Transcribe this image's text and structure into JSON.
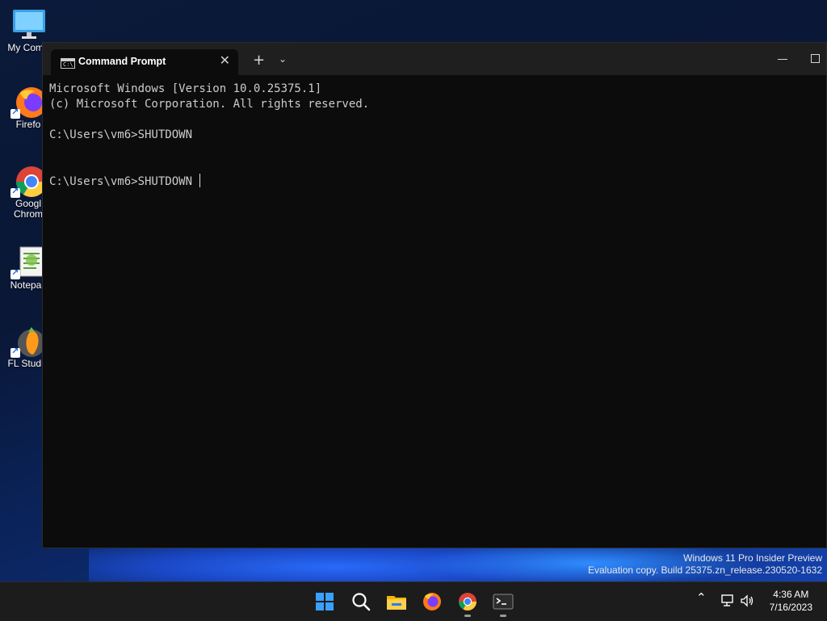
{
  "desktop": {
    "icons": [
      {
        "label": "My Comp"
      },
      {
        "label": "Firefo"
      },
      {
        "label": "Googl"
      },
      {
        "label": "Chrom"
      },
      {
        "label": "Notepac"
      },
      {
        "label": "FL Studio"
      }
    ]
  },
  "terminal": {
    "tab_title": "Command Prompt",
    "tab_close": "✕",
    "new_tab": "+",
    "dropdown": "⌄",
    "lines": [
      "Microsoft Windows [Version 10.0.25375.1]",
      "(c) Microsoft Corporation. All rights reserved.",
      "",
      "C:\\Users\\vm6>SHUTDOWN",
      "",
      "",
      "C:\\Users\\vm6>SHUTDOWN"
    ]
  },
  "watermark": {
    "line1": "Windows 11 Pro Insider Preview",
    "line2": "Evaluation copy. Build 25375.zn_release.230520-1632"
  },
  "taskbar": {
    "time": "4:36 AM",
    "date": "7/16/2023"
  },
  "colors": {
    "terminal_bg": "#0c0c0c",
    "titlebar_bg": "#1f1f1f",
    "taskbar_bg": "#1c1c1c",
    "accent": "#1a66d6"
  }
}
